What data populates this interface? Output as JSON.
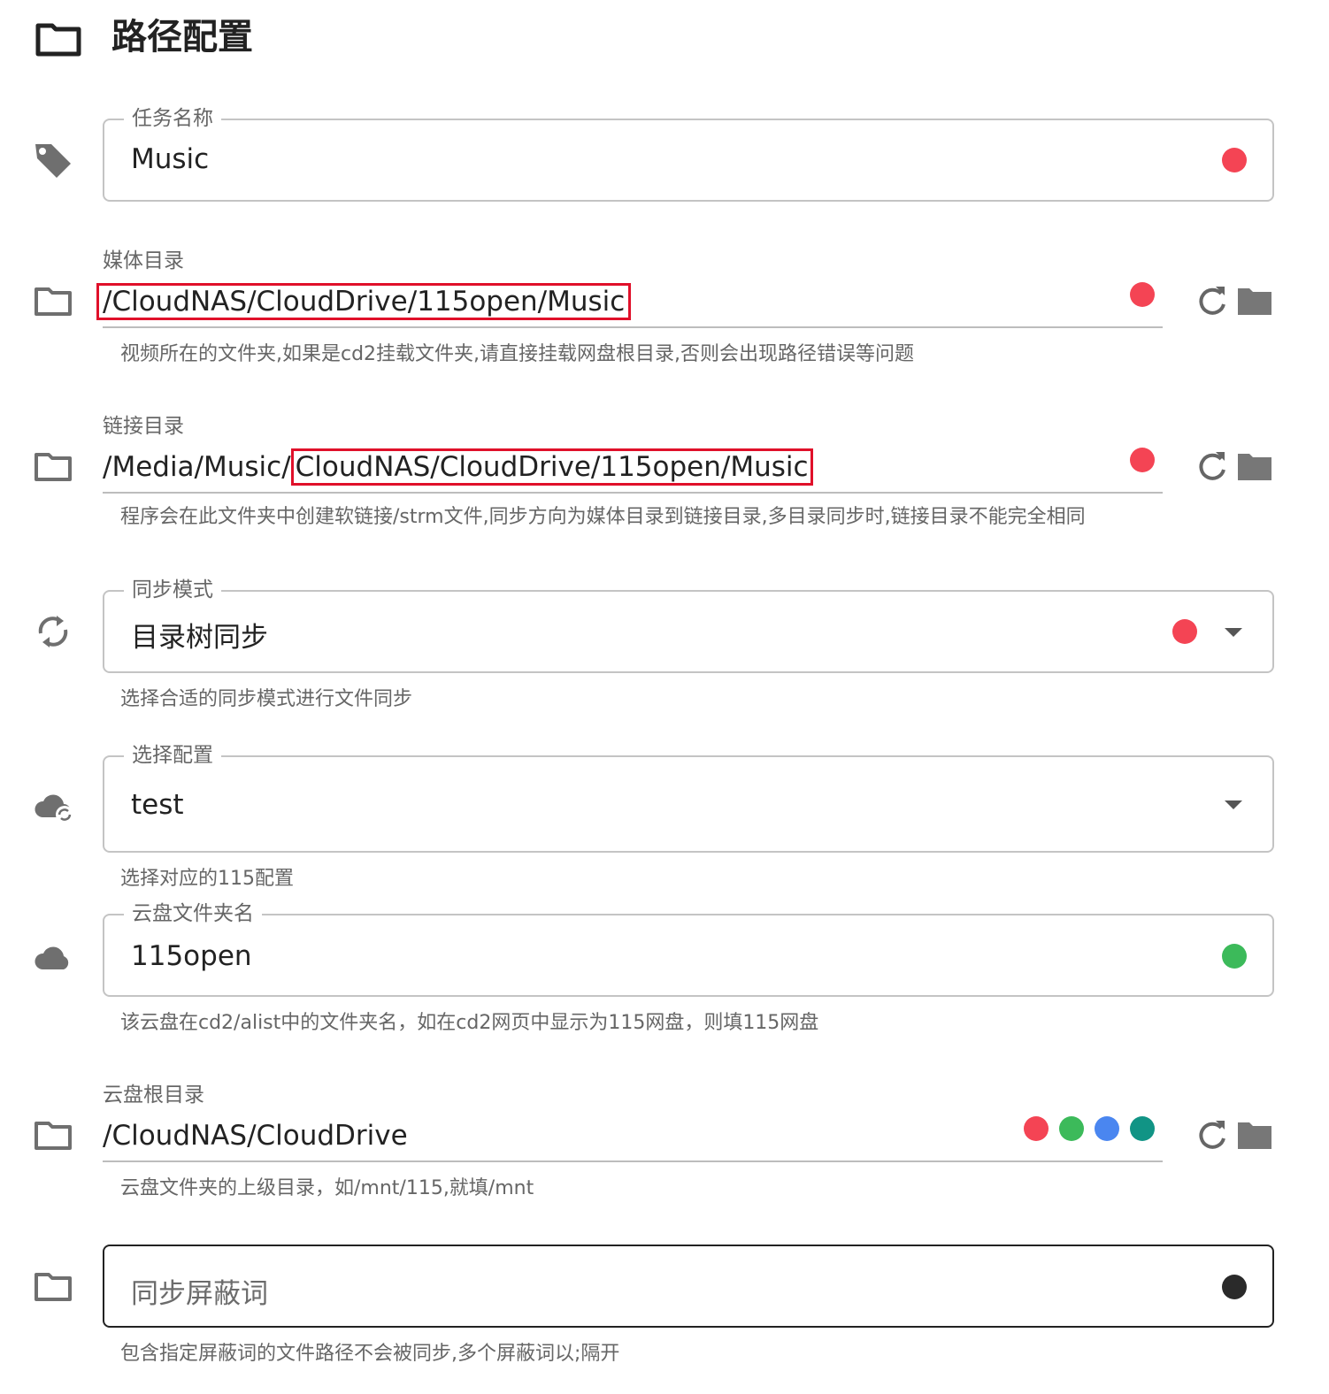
{
  "header": {
    "title": "路径配置",
    "icon": "folder-outline-icon"
  },
  "task_name": {
    "label": "任务名称",
    "value": "Music",
    "status_color": "#f44454",
    "icon": "tag-icon"
  },
  "media_dir": {
    "label": "媒体目录",
    "value": "/CloudNAS/CloudDrive/115open/Music",
    "helper": "视频所在的文件夹,如果是cd2挂载文件夹,请直接挂载网盘根目录,否则会出现路径错误等问题",
    "status_color": "#f44454",
    "highlight_color": "#e0102a",
    "icon": "folder-outline-icon"
  },
  "link_dir": {
    "label": "链接目录",
    "value_prefix": "/Media/Music/",
    "value_highlight": "CloudNAS/CloudDrive/115open/Music",
    "helper": "程序会在此文件夹中创建软链接/strm文件,同步方向为媒体目录到链接目录,多目录同步时,链接目录不能完全相同",
    "status_color": "#f44454",
    "icon": "folder-outline-icon"
  },
  "sync_mode": {
    "label": "同步模式",
    "value": "目录树同步",
    "helper": "选择合适的同步模式进行文件同步",
    "status_color": "#f44454",
    "icon": "sync-icon"
  },
  "config_select": {
    "label": "选择配置",
    "value": "test",
    "helper": "选择对应的115配置",
    "icon": "cloud-sync-icon"
  },
  "cloud_folder": {
    "label": "云盘文件夹名",
    "value": "115open",
    "helper": "该云盘在cd2/alist中的文件夹名，如在cd2网页中显示为115网盘，则填115网盘",
    "status_color": "#3cba5a",
    "icon": "cloud-icon"
  },
  "cloud_root": {
    "label": "云盘根目录",
    "value": "/CloudNAS/CloudDrive",
    "helper": "云盘文件夹的上级目录，如/mnt/115,就填/mnt",
    "status_colors": [
      "#f44454",
      "#3cba5a",
      "#4a86f0",
      "#119485"
    ],
    "icon": "folder-outline-icon"
  },
  "block_words": {
    "placeholder": "同步屏蔽词",
    "helper": "包含指定屏蔽词的文件路径不会被同步,多个屏蔽词以;隔开",
    "status_color": "#2a2a2a",
    "icon": "folder-outline-icon"
  },
  "actions": {
    "refresh_icon": "refresh-icon",
    "folder_icon": "folder-icon"
  }
}
